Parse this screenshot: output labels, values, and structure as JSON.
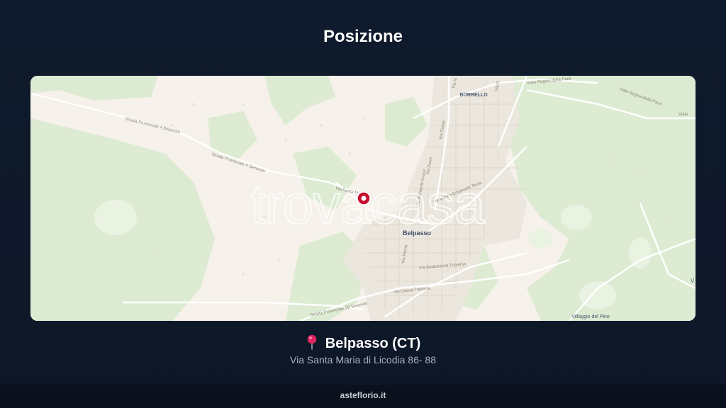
{
  "title": "Posizione",
  "map": {
    "watermark": "trovacasa",
    "places": {
      "borrello": "BORRELLO",
      "belpasso": "Belpasso",
      "villaggio": "Villaggio del Pino",
      "edge_v": "V"
    },
    "roads": {
      "strada_bel": "Strada Provinciale 4 Belpasso",
      "strada_sec": "Strada Provinciale 4 Secondo",
      "strada_58": "Strada Provinciale 58 Secondo",
      "via_santa": "Via Santa M...",
      "via_regina": "Viale Regina della Pace",
      "via_regina2": "Viale Regina della Pace",
      "via_vitt": "Via Vittorio Emanuele Terza",
      "via_fiume": "Via Fiume",
      "via_piave": "Via Piave",
      "via_roma": "Via Roma",
      "via_ottava": "Via Ottava Traversa",
      "via_dodic": "Via Dodicesima Traversa",
      "via_croce": "Via Piemonte Croce",
      "via_nord": "Via N",
      "via_r": "Via R",
      "viale_top": "Viale"
    },
    "colors": {
      "land": "#f6f1ea",
      "park": "#dcebd2",
      "urban": "#ece7de",
      "marker": "#c8102e"
    }
  },
  "location": {
    "pin_icon": "round-pushpin-icon",
    "name": "Belpasso (CT)",
    "address": "Via Santa Maria di Licodia 86- 88"
  },
  "footer": {
    "site": "asteflorio.it"
  }
}
